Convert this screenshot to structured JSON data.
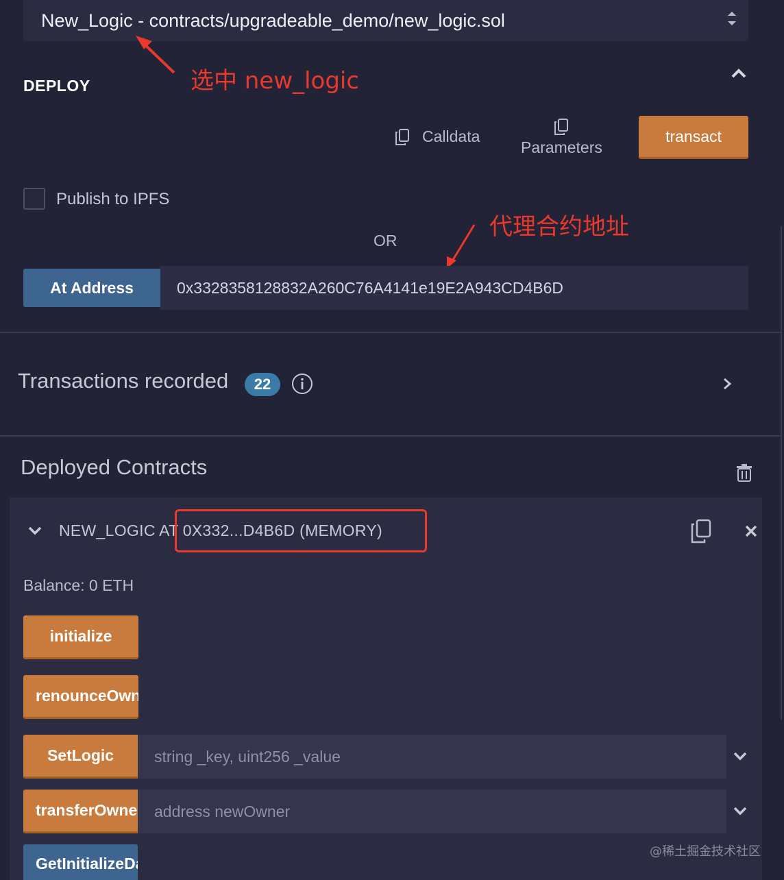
{
  "contract_select": {
    "value": "New_Logic - contracts/upgradeable_demo/new_logic.sol"
  },
  "annotations": {
    "select_note": "选中 new_logic",
    "proxy_note": "代理合约地址"
  },
  "deploy": {
    "title": "DEPLOY",
    "calldata_label": "Calldata",
    "parameters_label": "Parameters",
    "transact_label": "transact",
    "publish_label": "Publish to IPFS",
    "or_label": "OR",
    "at_address_label": "At Address",
    "at_address_value": "0x3328358128832A260C76A4141e19E2A943CD4B6D"
  },
  "transactions": {
    "title": "Transactions recorded",
    "count": "22"
  },
  "deployed": {
    "title": "Deployed Contracts",
    "instance_title": "NEW_LOGIC AT 0X332...D4B6D (MEMORY)",
    "balance": "Balance: 0 ETH",
    "functions": [
      {
        "label": "initialize",
        "color": "orange"
      },
      {
        "label": "renounceOwnership",
        "color": "orange"
      },
      {
        "label": "SetLogic",
        "color": "orange",
        "placeholder": "string _key, uint256 _value"
      },
      {
        "label": "transferOwnership",
        "color": "orange",
        "placeholder": "address newOwner"
      },
      {
        "label": "GetInitializeData",
        "color": "blue"
      }
    ]
  },
  "watermark": "@稀土掘金技术社区",
  "colors": {
    "background": "#222336",
    "panel": "#2b2c42",
    "orange": "#c97b3d",
    "blue": "#3d6590",
    "annotation_red": "#e8392c",
    "badge": "#3a7ca8"
  }
}
